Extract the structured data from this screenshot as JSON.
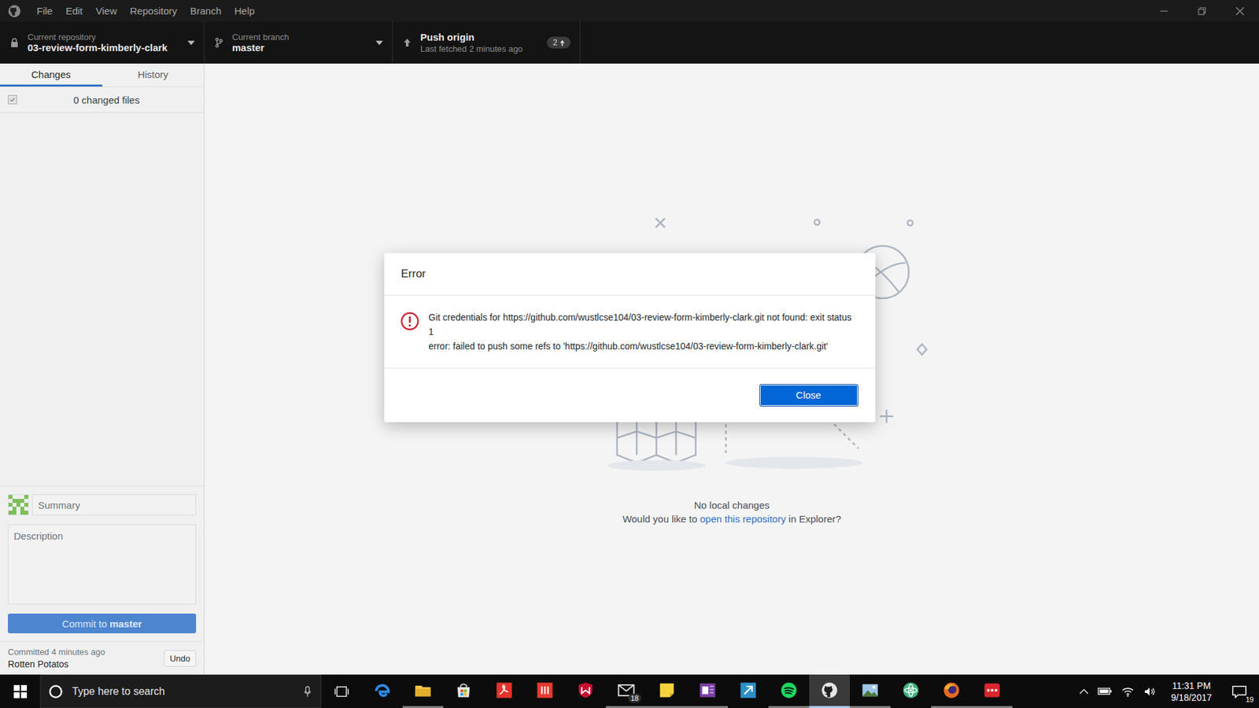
{
  "window": {
    "menu": [
      "File",
      "Edit",
      "View",
      "Repository",
      "Branch",
      "Help"
    ]
  },
  "toolbar": {
    "repository": {
      "label": "Current repository",
      "value": "03-review-form-kimberly-clark"
    },
    "branch": {
      "label": "Current branch",
      "value": "master"
    },
    "push": {
      "label": "Push origin",
      "detail": "Last fetched 2 minutes ago",
      "count": "2"
    }
  },
  "tabs": [
    {
      "label": "Changes",
      "selected": true
    },
    {
      "label": "History",
      "selected": false
    }
  ],
  "changes": {
    "summary": "0 changed files",
    "all_selected": true
  },
  "commit": {
    "summary_placeholder": "Summary",
    "description_placeholder": "Description",
    "button_prefix": "Commit to",
    "button_branch": "master",
    "disabled": true
  },
  "last_commit": {
    "text": "Committed 4 minutes ago",
    "title": "Rotten Potatos",
    "undo": "Undo"
  },
  "empty_state": {
    "title": "No local changes",
    "prompt": "Would you like to",
    "link": "open this repository",
    "suffix": "in Explorer?"
  },
  "dialog": {
    "title": "Error",
    "message_lines": [
      "Git credentials for https://github.com/wustlcse104/03-review-form-kimberly-clark.git not found: exit status 1",
      "error: failed to push some refs to 'https://github.com/wustlcse104/03-review-form-kimberly-clark.git'"
    ],
    "button": "Close"
  },
  "taskbar": {
    "search_placeholder": "Type here to search",
    "apps": [
      {
        "kind": "edge",
        "color": "#2b8ae6",
        "badge": "",
        "running": false,
        "selected": false
      },
      {
        "kind": "folder",
        "color": "#f2c744",
        "badge": "",
        "running": true,
        "selected": false
      },
      {
        "kind": "store",
        "color": "#e6e6e6",
        "badge": "",
        "running": false,
        "selected": false
      },
      {
        "kind": "acrobat",
        "color": "#e2322b",
        "badge": "",
        "running": false,
        "selected": false
      },
      {
        "kind": "bars",
        "color": "#e8392f",
        "badge": "",
        "running": false,
        "selected": false
      },
      {
        "kind": "shield",
        "color": "#c8102e",
        "badge": "",
        "running": false,
        "selected": false
      },
      {
        "kind": "mail",
        "color": "#e6e6e6",
        "badge": "18",
        "running": true,
        "selected": false
      },
      {
        "kind": "notes",
        "color": "#f5d33d",
        "badge": "",
        "running": true,
        "selected": false
      },
      {
        "kind": "onenote",
        "color": "#7b3fa8",
        "badge": "",
        "running": true,
        "selected": false
      },
      {
        "kind": "arrow",
        "color": "#2d8fc9",
        "badge": "",
        "running": false,
        "selected": false
      },
      {
        "kind": "spotify",
        "color": "#1ed760",
        "badge": "",
        "running": true,
        "selected": false
      },
      {
        "kind": "github",
        "color": "#e6e6e6",
        "badge": "",
        "running": true,
        "selected": true
      },
      {
        "kind": "photo",
        "color": "#9cc7e8",
        "badge": "",
        "running": true,
        "selected": false
      },
      {
        "kind": "atom",
        "color": "#3fb37f",
        "badge": "",
        "running": false,
        "selected": false
      },
      {
        "kind": "firefox",
        "color": "#e66a1f",
        "badge": "",
        "running": true,
        "selected": false
      },
      {
        "kind": "dots",
        "color": "#d9262c",
        "badge": "",
        "running": true,
        "selected": false
      }
    ],
    "time": "11:31 PM",
    "date": "9/18/2017",
    "notifications": "19"
  }
}
